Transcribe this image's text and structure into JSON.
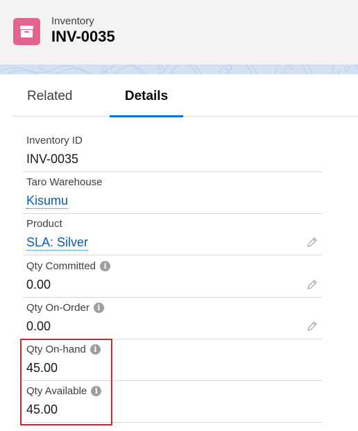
{
  "header": {
    "object_label": "Inventory",
    "record_name": "INV-0035",
    "icon": "inventory-box-icon",
    "icon_color": "#e3658e"
  },
  "tabs": [
    {
      "label": "Related",
      "active": false
    },
    {
      "label": "Details",
      "active": true
    }
  ],
  "accent_color": "#0176d3",
  "highlight_color": "#e0202a",
  "fields": {
    "inventory_id": {
      "label": "Inventory ID",
      "value": "INV-0035"
    },
    "warehouse": {
      "label": "Taro Warehouse",
      "value": "Kisumu"
    },
    "product": {
      "label": "Product",
      "value": "SLA: Silver"
    },
    "qty_committed": {
      "label": "Qty Committed",
      "value": "0.00"
    },
    "qty_on_order": {
      "label": "Qty On-Order",
      "value": "0.00"
    },
    "qty_on_hand": {
      "label": "Qty On-hand",
      "value": "45.00"
    },
    "qty_available": {
      "label": "Qty Available",
      "value": "45.00"
    }
  }
}
